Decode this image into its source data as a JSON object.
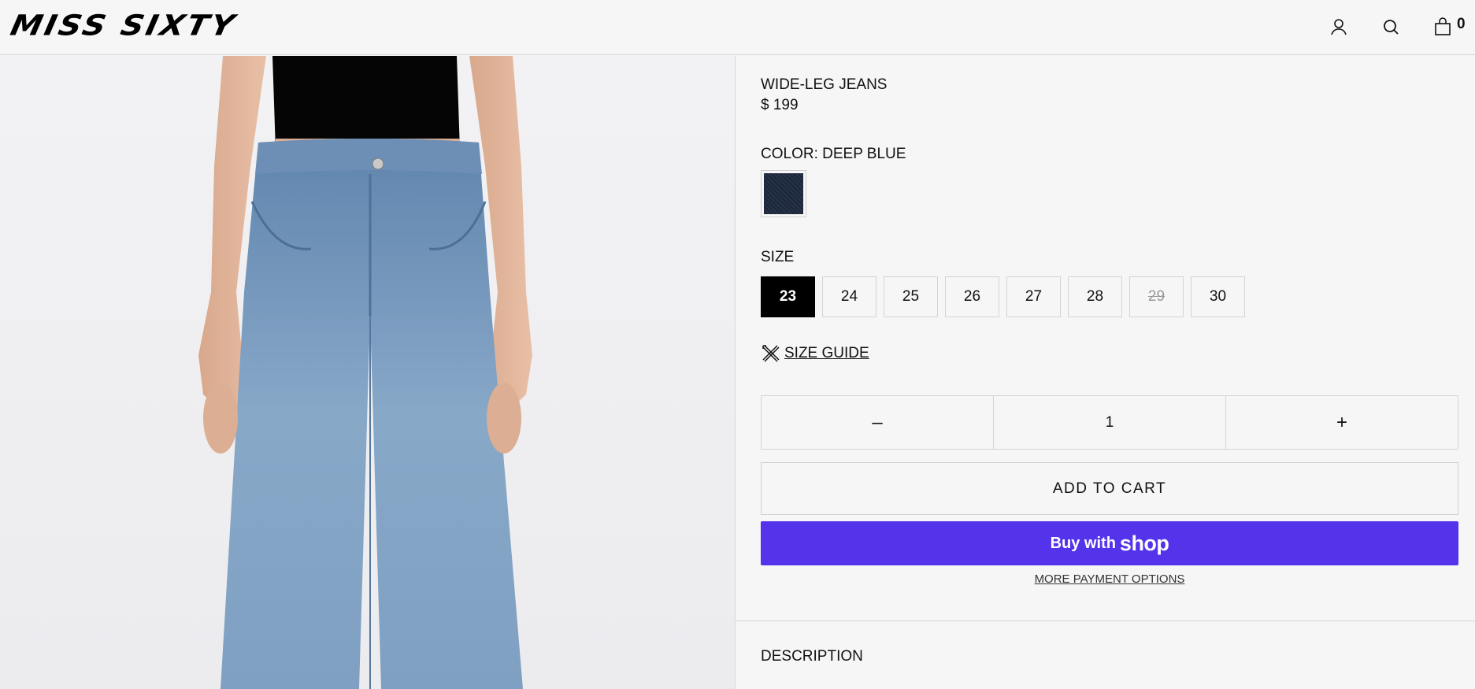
{
  "header": {
    "logo": "MISS SIXTY",
    "cart_count": "0",
    "icons": [
      "user-icon",
      "search-icon",
      "bag-icon"
    ]
  },
  "product": {
    "title": "WIDE-LEG JEANS",
    "price": "$ 199",
    "color_label": "COLOR: DEEP BLUE",
    "swatch_color": "#243047",
    "size_label": "SIZE",
    "sizes": [
      {
        "label": "23",
        "state": "selected"
      },
      {
        "label": "24",
        "state": "available"
      },
      {
        "label": "25",
        "state": "available"
      },
      {
        "label": "26",
        "state": "available"
      },
      {
        "label": "27",
        "state": "available"
      },
      {
        "label": "28",
        "state": "available"
      },
      {
        "label": "29",
        "state": "unavailable"
      },
      {
        "label": "30",
        "state": "available"
      }
    ],
    "size_guide": "SIZE GUIDE",
    "quantity": {
      "minus": "–",
      "value": "1",
      "plus": "+"
    },
    "add_to_cart": "ADD TO CART",
    "shop_pay": {
      "buy_with": "Buy with",
      "brand": "shop",
      "color": "#5433eb"
    },
    "more_payment": "MORE PAYMENT OPTIONS",
    "description": "DESCRIPTION"
  }
}
